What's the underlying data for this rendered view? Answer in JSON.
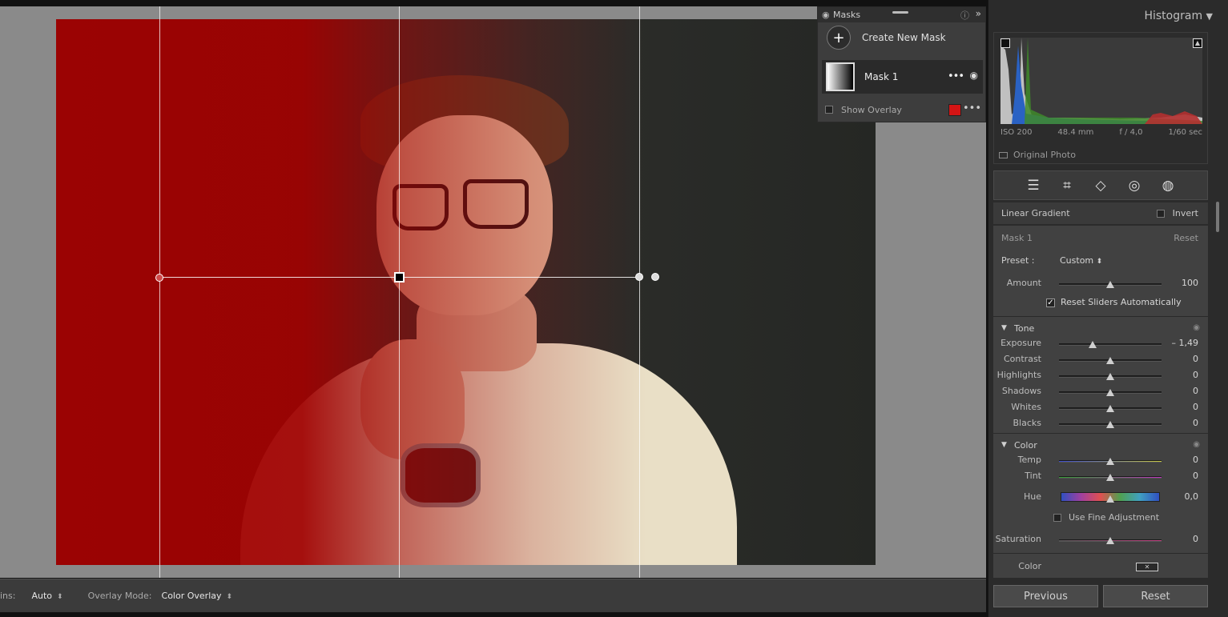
{
  "masks": {
    "title": "Masks",
    "create_label": "Create New Mask",
    "mask_name": "Mask 1",
    "show_overlay_label": "Show Overlay",
    "overlay_color": "#d41414"
  },
  "toolbar": {
    "pins_label": "ins:",
    "pins_value": "Auto",
    "overlay_mode_label": "Overlay Mode:",
    "overlay_mode_value": "Color Overlay"
  },
  "histogram": {
    "title": "Histogram",
    "iso": "ISO 200",
    "focal": "48.4 mm",
    "aperture": "f / 4,0",
    "shutter": "1/60 sec",
    "original_photo_label": "Original Photo"
  },
  "tools": [
    "sliders-icon",
    "crop-icon",
    "eraser-icon",
    "redeye-icon",
    "mask-icon"
  ],
  "mask_panel": {
    "gradient_label": "Linear Gradient",
    "invert_label": "Invert",
    "mask_label": "Mask 1",
    "reset_label": "Reset",
    "preset_label": "Preset :",
    "preset_value": "Custom",
    "amount_label": "Amount",
    "amount_value": "100",
    "amount_pos": 0.5,
    "reset_sliders_label": "Reset Sliders Automatically",
    "reset_sliders_checked": true
  },
  "tone": {
    "title": "Tone",
    "sliders": [
      {
        "label": "Exposure",
        "value": "– 1,49",
        "pos": 0.33
      },
      {
        "label": "Contrast",
        "value": "0",
        "pos": 0.5
      },
      {
        "label": "Highlights",
        "value": "0",
        "pos": 0.5
      },
      {
        "label": "Shadows",
        "value": "0",
        "pos": 0.5
      },
      {
        "label": "Whites",
        "value": "0",
        "pos": 0.5
      },
      {
        "label": "Blacks",
        "value": "0",
        "pos": 0.5
      }
    ]
  },
  "color": {
    "title": "Color",
    "temp_label": "Temp",
    "temp_value": "0",
    "tint_label": "Tint",
    "tint_value": "0",
    "hue_label": "Hue",
    "hue_value": "0,0",
    "fine_adjust_label": "Use Fine Adjustment",
    "saturation_label": "Saturation",
    "saturation_value": "0",
    "color_label": "Color"
  },
  "nav": {
    "previous_label": "Previous",
    "reset_label": "Reset"
  }
}
